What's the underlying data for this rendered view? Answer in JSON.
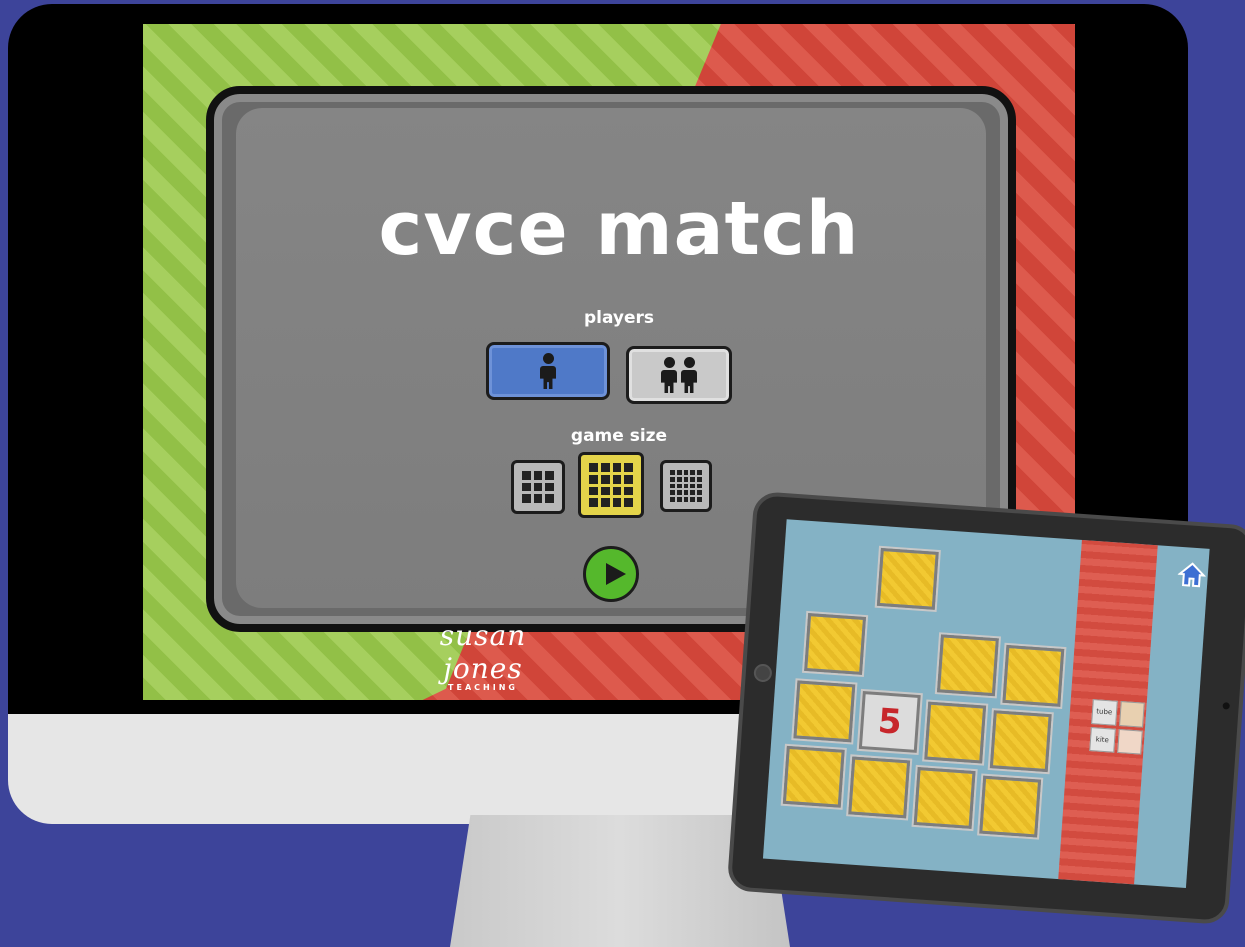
{
  "game": {
    "title": "cvce match",
    "players_label": "players",
    "game_size_label": "game size",
    "players_selected": "one",
    "size_selected": "medium"
  },
  "brand": {
    "name": "susan jones",
    "sub": "TEACHING"
  },
  "tablet": {
    "revealed_card_value": "5",
    "side_words": [
      "tube",
      "kite"
    ]
  },
  "colors": {
    "background": "#3d449a",
    "green_stripe": "#92c047",
    "red_stripe": "#d04539",
    "player_selected": "#4f79c8",
    "size_selected": "#e4d44a",
    "play": "#55b82c",
    "card": "#f2c932"
  },
  "icons": [
    "person-icon",
    "grid-icon",
    "play-icon",
    "home-icon"
  ]
}
